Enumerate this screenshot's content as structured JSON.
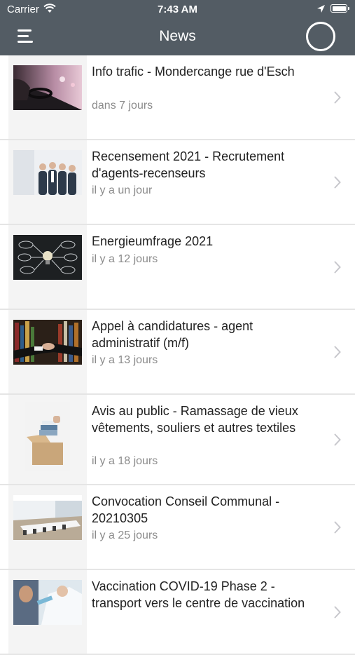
{
  "status_bar": {
    "carrier": "Carrier",
    "time": "7:43 AM"
  },
  "header": {
    "title": "News"
  },
  "icons": [
    "wifi-icon",
    "location-arrow-icon",
    "battery-icon",
    "menu-icon",
    "circle-icon",
    "chevron-right-icon"
  ],
  "colors": {
    "header_bg": "#535c64",
    "date_text": "#8b8b8b",
    "title_text": "#222222",
    "separator": "#e5e5e5"
  },
  "news": [
    {
      "title": "Info trafic - Mondercange rue d'Esch",
      "date": "dans 7 jours",
      "image": "car-traffic-photo"
    },
    {
      "title": "Recensement 2021 - Recrutement d'agents-recenseurs",
      "date": "il y a un jour",
      "image": "business-team-photo"
    },
    {
      "title": "Energieumfrage 2021",
      "date": "il y a 12 jours",
      "image": "lightbulb-chalkboard-photo"
    },
    {
      "title": "Appel à candidatures - agent administratif (m/f)",
      "date": "il y a 13 jours",
      "image": "handshake-photo"
    },
    {
      "title": "Avis au public - Ramassage de vieux vêtements, souliers et autres textiles",
      "date": "il y a 18 jours",
      "image": "clothes-box-photo"
    },
    {
      "title": "Convocation Conseil Communal - 20210305",
      "date": "il y a 25 jours",
      "image": "conference-room-photo"
    },
    {
      "title": "Vaccination COVID-19 Phase 2 - transport vers le centre de vaccination",
      "date": "",
      "image": "vaccination-photo"
    }
  ]
}
